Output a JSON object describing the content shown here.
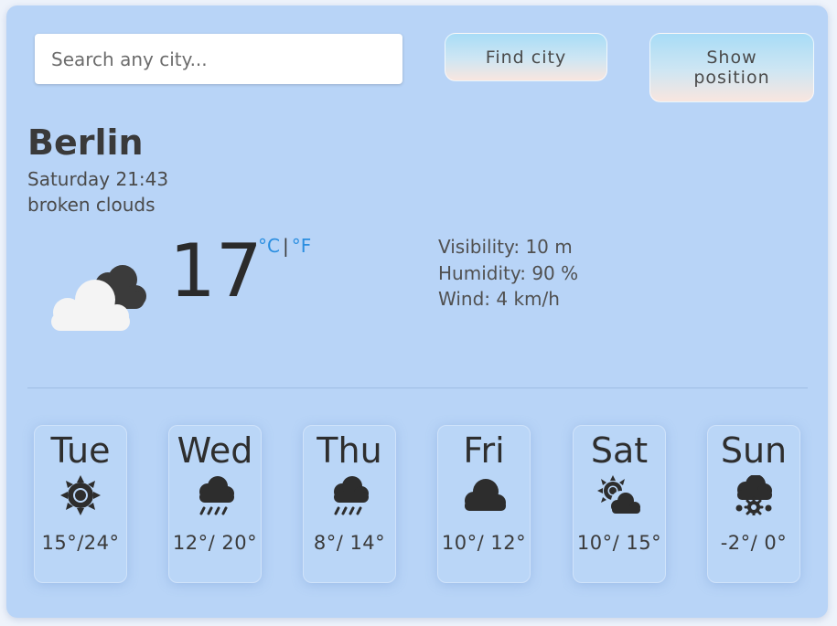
{
  "search": {
    "placeholder": "Search any city..."
  },
  "buttons": {
    "find_city": "Find city",
    "show_position": "Show position"
  },
  "current": {
    "city": "Berlin",
    "datetime": "Saturday 21:43",
    "description": "broken clouds",
    "temperature": "17",
    "unit_c": "°C",
    "unit_sep": "|",
    "unit_f": "°F",
    "icon": "broken-clouds-icon",
    "visibility": "Visibility: 10 m",
    "humidity": "Humidity: 90 %",
    "wind": "Wind: 4 km/h"
  },
  "forecast": [
    {
      "day": "Tue",
      "icon": "sun-icon",
      "temps": "15°/24°"
    },
    {
      "day": "Wed",
      "icon": "rain-icon",
      "temps": "12°/ 20°"
    },
    {
      "day": "Thu",
      "icon": "rain-icon",
      "temps": "8°/ 14°"
    },
    {
      "day": "Fri",
      "icon": "cloud-icon",
      "temps": "10°/ 12°"
    },
    {
      "day": "Sat",
      "icon": "partly-cloudy-icon",
      "temps": "10°/ 15°"
    },
    {
      "day": "Sun",
      "icon": "snow-icon",
      "temps": "-2°/ 0°"
    }
  ],
  "colors": {
    "card": "#b8d4f7",
    "accent": "#2a8ee0",
    "icon_dark": "#2d2d2d"
  }
}
